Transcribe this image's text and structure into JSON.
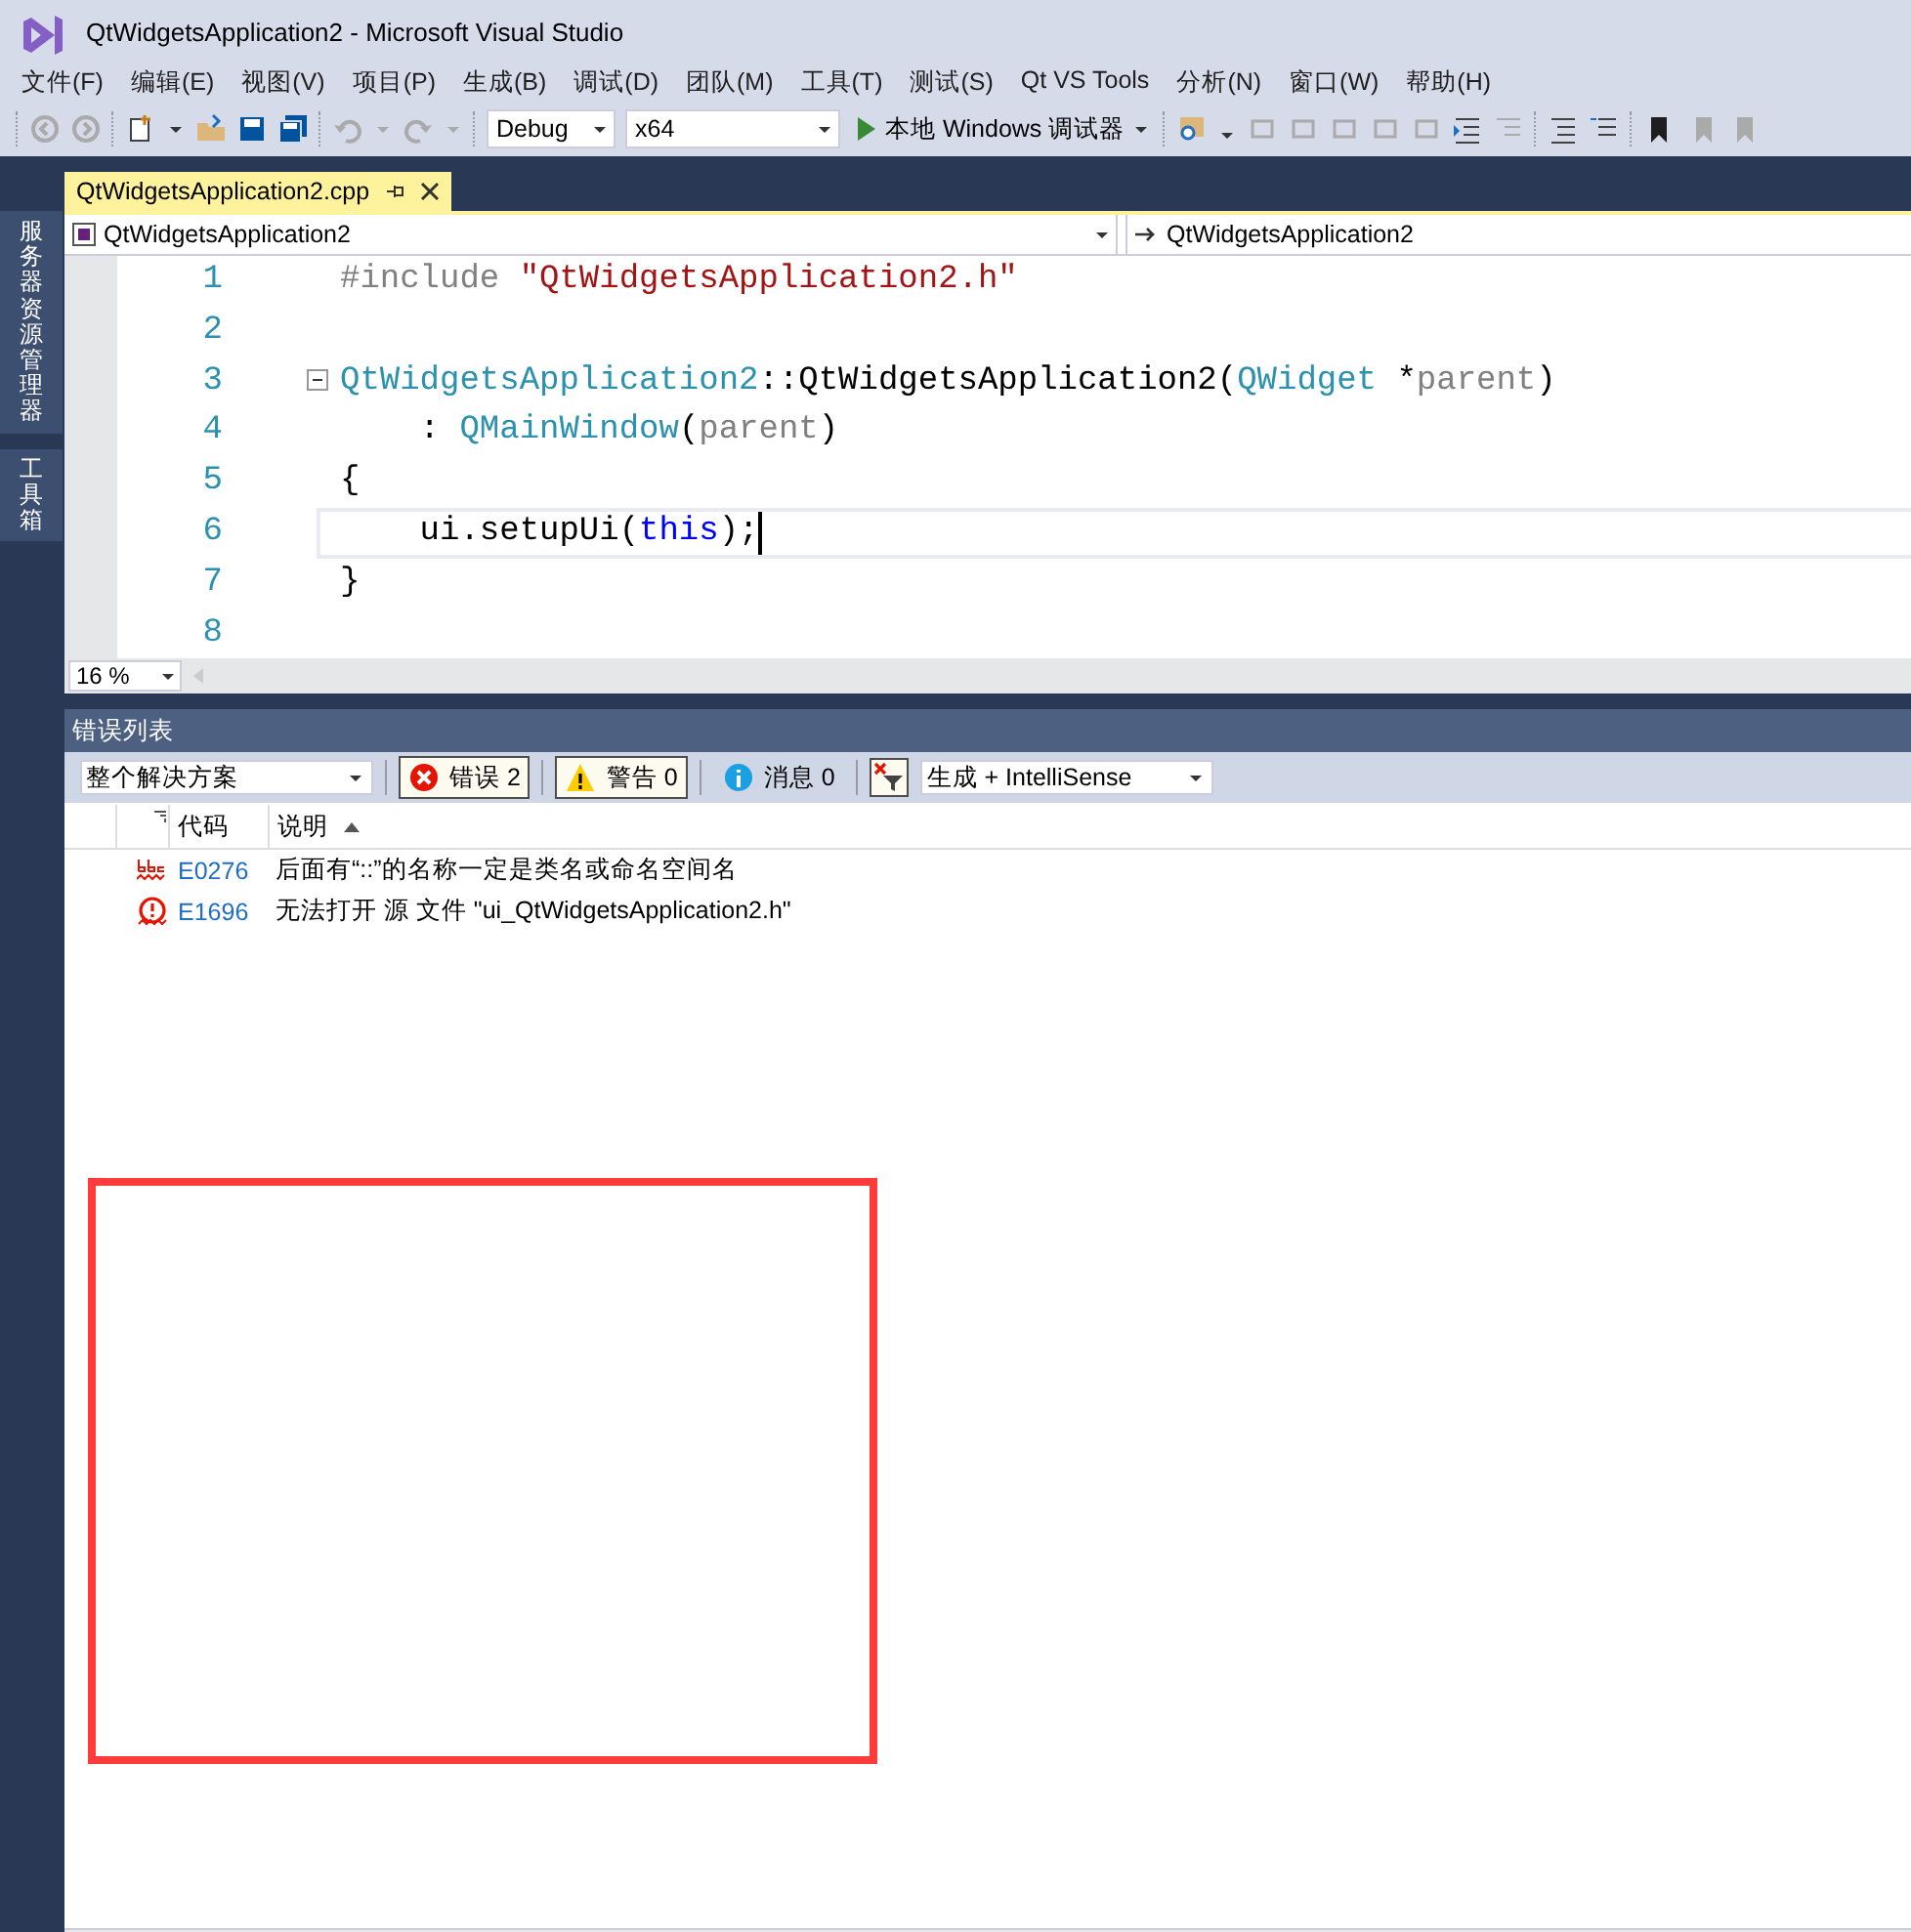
{
  "window": {
    "title": "QtWidgetsApplication2 - Microsoft Visual Studio"
  },
  "menu": [
    "文件(F)",
    "编辑(E)",
    "视图(V)",
    "项目(P)",
    "生成(B)",
    "调试(D)",
    "团队(M)",
    "工具(T)",
    "测试(S)",
    "Qt VS Tools",
    "分析(N)",
    "窗口(W)",
    "帮助(H)"
  ],
  "toolbar": {
    "configuration": "Debug",
    "platform": "x64",
    "run_button": "本地 Windows 调试器"
  },
  "side_tabs": [
    "服务器资源管理器",
    "工具箱"
  ],
  "document_tab": {
    "title": "QtWidgetsApplication2.cpp",
    "selected": true
  },
  "navigation_bar": {
    "scope": "QtWidgetsApplication2",
    "member": "QtWidgetsApplication2"
  },
  "code_lines": [
    {
      "number": "1",
      "fold": false,
      "current": false,
      "tokens": [
        {
          "kind": "preprocessor",
          "text": "#include "
        },
        {
          "kind": "string",
          "text": "\"QtWidgetsApplication2.h\""
        }
      ]
    },
    {
      "number": "2",
      "fold": false,
      "current": false
    },
    {
      "number": "3",
      "fold": true,
      "current": false,
      "tokens": [
        {
          "kind": "type",
          "text": "QtWidgetsApplication2"
        },
        {
          "kind": "plain",
          "text": "::QtWidgetsApplication2("
        },
        {
          "kind": "type",
          "text": "QWidget"
        },
        {
          "kind": "plain",
          "text": " *"
        },
        {
          "kind": "parameter",
          "text": "parent"
        },
        {
          "kind": "plain",
          "text": ")"
        }
      ]
    },
    {
      "number": "4",
      "fold": false,
      "current": false,
      "tokens": [
        {
          "kind": "plain",
          "text": "    : "
        },
        {
          "kind": "type",
          "text": "QMainWindow"
        },
        {
          "kind": "plain",
          "text": "("
        },
        {
          "kind": "parameter",
          "text": "parent"
        },
        {
          "kind": "plain",
          "text": ")"
        }
      ]
    },
    {
      "number": "5",
      "fold": false,
      "current": false,
      "tokens": [
        {
          "kind": "plain",
          "text": "{"
        }
      ]
    },
    {
      "number": "6",
      "fold": false,
      "current": true,
      "tokens": [
        {
          "kind": "plain",
          "text": "    ui.setupUi("
        },
        {
          "kind": "keyword",
          "text": "this"
        },
        {
          "kind": "plain",
          "text": ");"
        }
      ]
    },
    {
      "number": "7",
      "fold": false,
      "current": false,
      "tokens": [
        {
          "kind": "plain",
          "text": "}"
        }
      ]
    },
    {
      "number": "8",
      "fold": false,
      "current": false
    }
  ],
  "zoom": "16 %",
  "error_list": {
    "title": "错误列表",
    "scope": "整个解决方案",
    "filters": [
      {
        "kind": "error",
        "label": "错误 2",
        "selected": true
      },
      {
        "kind": "warning",
        "label": "警告 0",
        "selected": true
      },
      {
        "kind": "info",
        "label": "消息 0",
        "selected": false
      }
    ],
    "source": "生成 + IntelliSense",
    "columns": [
      "代码",
      "说明"
    ],
    "rows": [
      {
        "kind": "spelling",
        "code": "E0276",
        "description": "后面有“::”的名称一定是类名或命名空间名"
      },
      {
        "kind": "error",
        "code": "E1696",
        "description": "无法打开 源 文件 \"ui_QtWidgetsApplication2.h\""
      }
    ]
  }
}
